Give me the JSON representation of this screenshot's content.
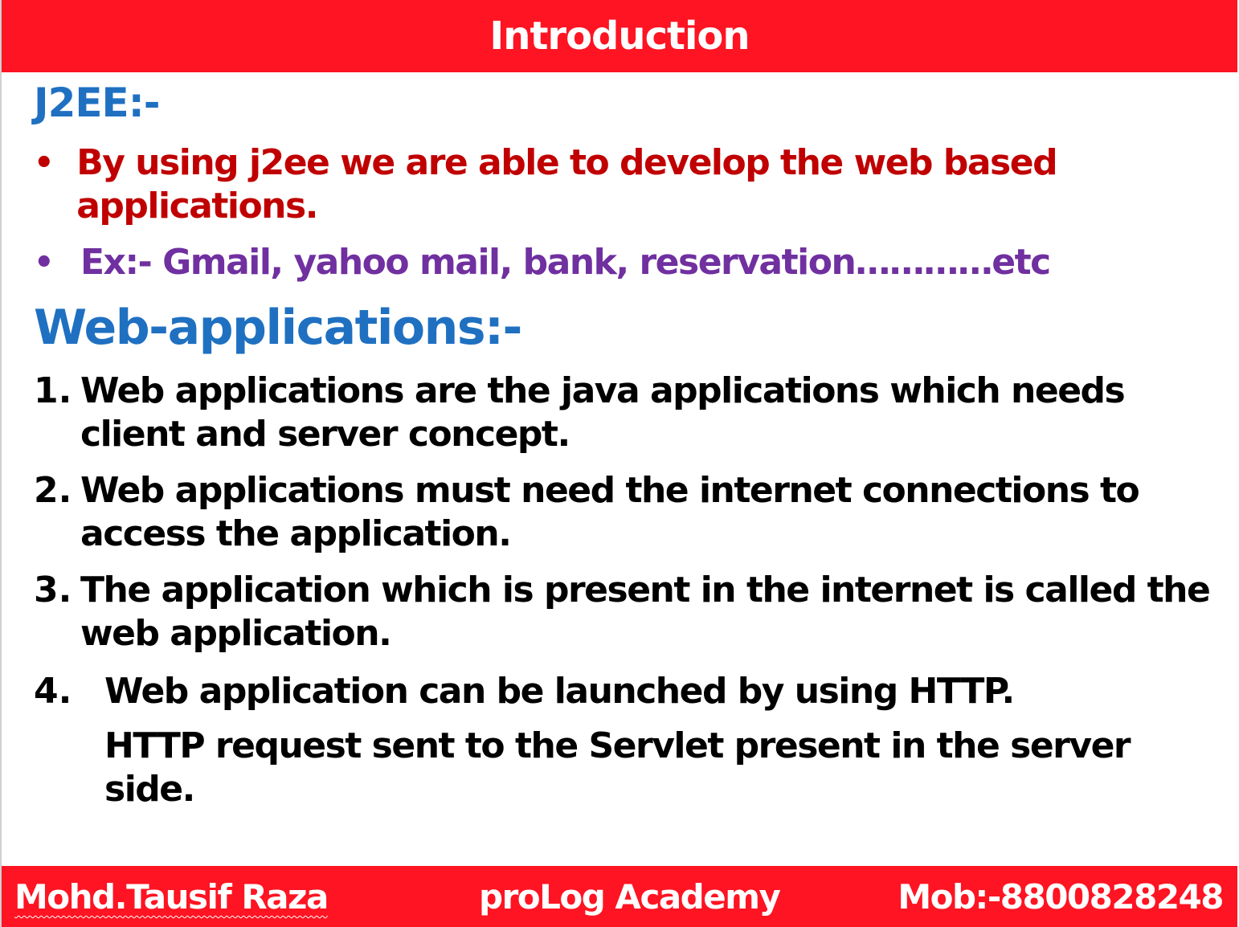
{
  "header": {
    "title": "Introduction"
  },
  "j2ee": {
    "heading": "J2EE:-",
    "bullets": [
      "By using j2ee we are able to develop the web based applications.",
      "Ex:- Gmail, yahoo mail, bank, reservation…………etc"
    ]
  },
  "web_apps": {
    "heading": "Web-applications:-",
    "items": [
      {
        "num": "1.",
        "text": "Web applications are the java applications which needs client and server concept."
      },
      {
        "num": "2.",
        "text": "Web applications must need the internet connections to access the application."
      },
      {
        "num": "3.",
        "text": "The application which is present in the internet is called the web application."
      },
      {
        "num": "4.",
        "text": "Web application can be launched by using HTTP.",
        "subtext": "HTTP request sent to the Servlet present in the server side."
      }
    ]
  },
  "footer": {
    "author": "Mohd.Tausif Raza",
    "academy": "proLog Academy",
    "mobile": "Mob:-8800828248"
  },
  "colors": {
    "banner": "#fe1422",
    "heading_blue": "#1f70c1",
    "bullet_red": "#c00000",
    "bullet_purple": "#7030a0"
  }
}
